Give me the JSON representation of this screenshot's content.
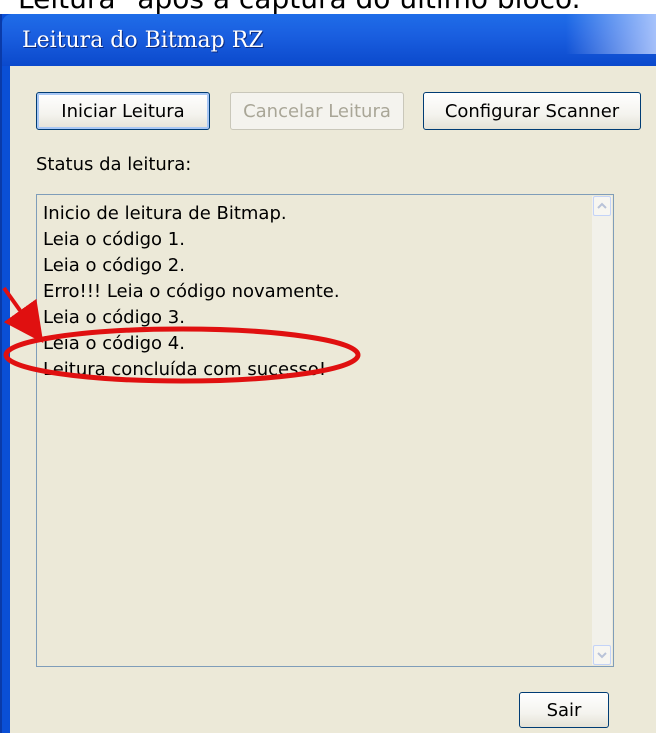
{
  "caption": "Leitura\" após a captura do último bloco.",
  "window": {
    "title": "Leitura do Bitmap RZ"
  },
  "toolbar": {
    "start_label": "Iniciar Leitura",
    "cancel_label": "Cancelar Leitura",
    "config_label": "Configurar Scanner"
  },
  "status": {
    "label": "Status da leitura:",
    "lines": [
      "Inicio de leitura de Bitmap.",
      "Leia o código 1.",
      "Leia o código 2.",
      "Erro!!! Leia o código novamente.",
      "Leia o código 3.",
      "Leia o código 4.",
      "Leitura concluída com sucesso!"
    ]
  },
  "footer": {
    "exit_label": "Sair"
  },
  "annotation": {
    "color": "#e01010"
  }
}
